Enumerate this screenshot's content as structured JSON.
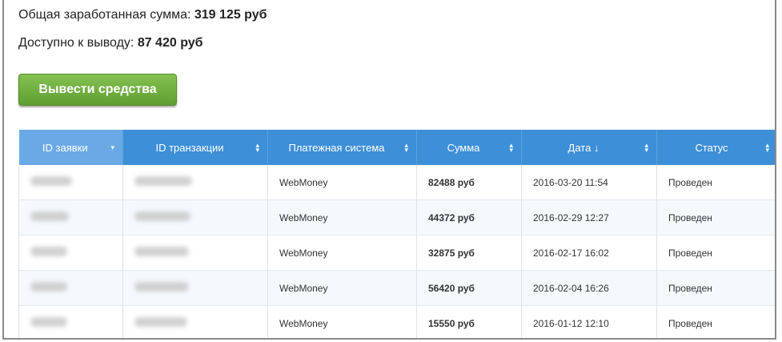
{
  "summary": {
    "total_label": "Общая заработанная сумма:",
    "total_value": "319 125 руб",
    "available_label": "Доступно к выводу:",
    "available_value": "87 420 руб"
  },
  "withdraw_button": "Вывести средства",
  "table": {
    "columns": [
      "ID заявки",
      "ID транзакции",
      "Платежная система",
      "Сумма",
      "Дата ↓",
      "Статус"
    ],
    "sorted_column": "ID заявки",
    "rows": [
      {
        "system": "WebMoney",
        "amount": "82488 руб",
        "date": "2016-03-20 11:54",
        "status": "Проведен"
      },
      {
        "system": "WebMoney",
        "amount": "44372 руб",
        "date": "2016-02-29 12:27",
        "status": "Проведен"
      },
      {
        "system": "WebMoney",
        "amount": "32875 руб",
        "date": "2016-02-17 16:02",
        "status": "Проведен"
      },
      {
        "system": "WebMoney",
        "amount": "56420 руб",
        "date": "2016-02-04 16:26",
        "status": "Проведен"
      },
      {
        "system": "WebMoney",
        "amount": "15550 руб",
        "date": "2016-01-12 12:10",
        "status": "Проведен"
      }
    ]
  },
  "colors": {
    "header_bg": "#3d8fd8",
    "header_sorted_bg": "#6aa9e6",
    "button_green": "#6fae3e",
    "status_green": "#4b8a1f"
  },
  "icons": {
    "sort": "sort-arrows-icon",
    "sort_desc": "sort-desc-icon"
  }
}
